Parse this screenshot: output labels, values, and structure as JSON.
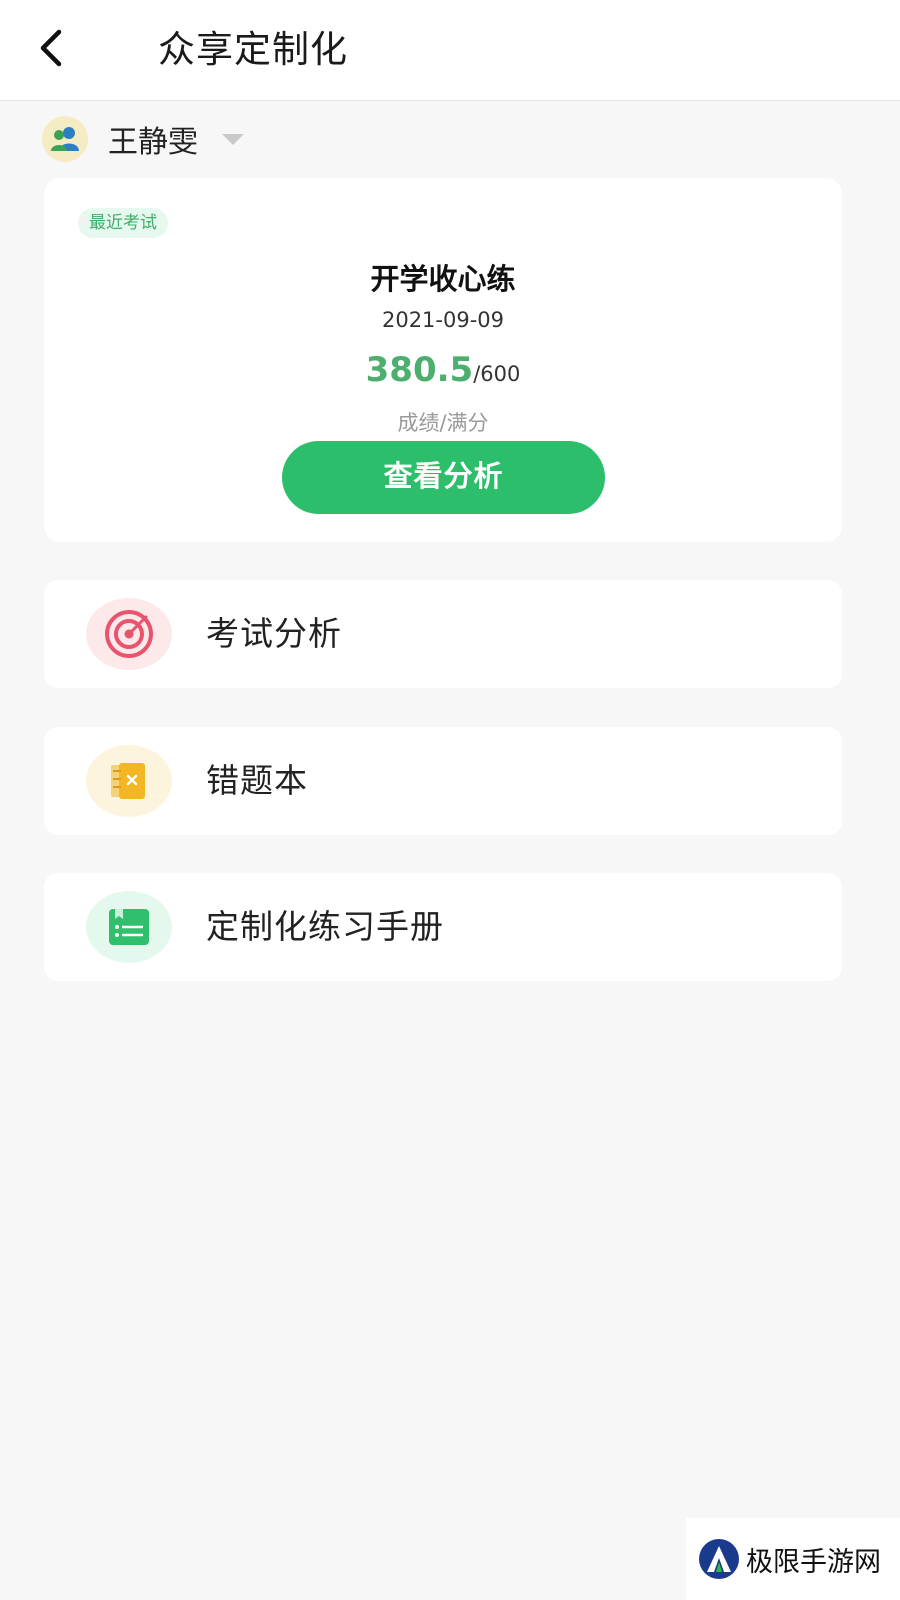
{
  "header": {
    "title": "众享定制化",
    "back_icon": "chevron-left-icon"
  },
  "user": {
    "name": "王静雯",
    "avatar_icon": "users-icon",
    "dropdown_icon": "caret-down-icon"
  },
  "recent_exam": {
    "badge": "最近考试",
    "title": "开学收心练",
    "date": "2021-09-09",
    "score": "380.5",
    "separator": "/",
    "full_score": "600",
    "caption": "成绩/满分",
    "button_label": "查看分析"
  },
  "menu": [
    {
      "label": "考试分析",
      "icon": "target-icon",
      "icon_bg": "#fde8ea"
    },
    {
      "label": "错题本",
      "icon": "notebook-icon",
      "icon_bg": "#fdf4dd"
    },
    {
      "label": "定制化练习手册",
      "icon": "book-list-icon",
      "icon_bg": "#e5f8ee"
    }
  ],
  "watermark": {
    "text": "极限手游网"
  },
  "colors": {
    "accent": "#2dbe6c",
    "score": "#4caf6e",
    "background": "#f7f7f7"
  }
}
